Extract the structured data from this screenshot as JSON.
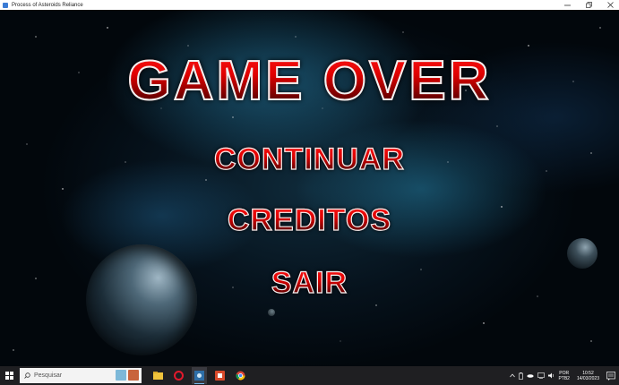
{
  "window": {
    "title": "Process of Asteroids Reliance"
  },
  "game": {
    "title": "GAME OVER",
    "menu": [
      {
        "label": "CONTINUAR"
      },
      {
        "label": "CREDITOS"
      },
      {
        "label": "SAIR"
      }
    ],
    "colors": {
      "text_fill": "#e00000",
      "text_outline": "#f2f2f2",
      "background": "#06121c"
    }
  },
  "taskbar": {
    "search_placeholder": "Pesquisar",
    "apps": [
      {
        "icon": "file-explorer-icon"
      },
      {
        "icon": "opera-icon"
      },
      {
        "icon": "game-app-icon",
        "active": true
      },
      {
        "icon": "office-icon"
      },
      {
        "icon": "chrome-icon"
      }
    ],
    "language": {
      "line1": "POR",
      "line2": "PTB2"
    },
    "clock": {
      "time": "10:52",
      "date": "14/03/2023"
    }
  }
}
